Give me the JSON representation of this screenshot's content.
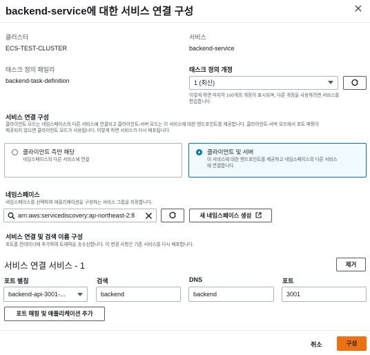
{
  "dialog": {
    "title": "backend-service에 대한 서비스 연결 구성",
    "close": "✕"
  },
  "cluster": {
    "label": "클러스터",
    "value": "ECS-TEST-CLUSTER"
  },
  "service": {
    "label": "서비스",
    "value": "backend-service"
  },
  "task_family": {
    "label": "태스크 정의 패밀리",
    "value": "backend-task-definition"
  },
  "task_revision": {
    "label": "태스크 정의 개정",
    "value": "1 (최신)",
    "desc_line1": "이렇게 하면 마지막 100개의 개정이 표시되며, 다른 개정을 사용하려면 서비스를",
    "desc_line2": "편집합니다."
  },
  "service_connect": {
    "label": "서비스 연결 구성",
    "desc_line1": "클라이언트 모드는 네임스페이스의 다른 서비스에 연결되고 클라이언트-서버 모드는 이 서비스에 대한 엔드포인트를 제공합니다. 클라이언트-서버 모드에서 포트 매핑이",
    "desc_line2": "제공되지 않으면 클라이언트 모드가 사용됩니다. 이렇게 하면 서비스가 다시 배포됩니다.",
    "option_client_title": "클라이언트 측만 해당",
    "option_client_desc": "네임스페이스의 다른 서비스에 연결",
    "option_server_title": "클라이언트 및 서버",
    "option_server_desc_line1": "이 서비스에 대한 엔드포인트를 제공하고 네임스페이스의 다른 서비스",
    "option_server_desc_line2": "에 연결합니다."
  },
  "namespace": {
    "label": "네임스페이스",
    "desc": "네임스페이스를 선택하여 애플리케이션을 구성하는 서비스 그룹을 지정합니다.",
    "value": "arn:aws:servicediscovery:ap-northeast-2:8",
    "create_button": "새 네임스페이스 생성"
  },
  "discovery": {
    "label": "서비스 연결 및 검색 이름 구성",
    "desc": "포트를 컨테이너에 추가하여 트래픽을 송수신합니다. 이 변경 사항은 기존 서비스를 다시 배포합니다."
  },
  "cs_service": {
    "heading": "서비스 연결 서비스 - 1",
    "remove_button": "제거",
    "port_alias_label": "포트 별칭",
    "port_alias_value": "backend-api-3001-...",
    "discovery_label": "검색",
    "discovery_value": "backend",
    "dns_label": "DNS",
    "dns_value": "backend",
    "port_label": "포트",
    "port_value": "3001",
    "add_button": "포트 매핑 및 애플리케이션 추가"
  },
  "footer": {
    "cancel": "취소",
    "submit": "구성"
  },
  "colors": {
    "primary": "#ec7211",
    "selected_border": "#0073bb",
    "selected_bg": "#f1faff"
  },
  "icons": {
    "close": "close-icon",
    "refresh": "refresh-icon",
    "search": "search-icon",
    "clear": "clear-icon",
    "external": "external-link-icon",
    "caret": "caret-down-icon"
  }
}
